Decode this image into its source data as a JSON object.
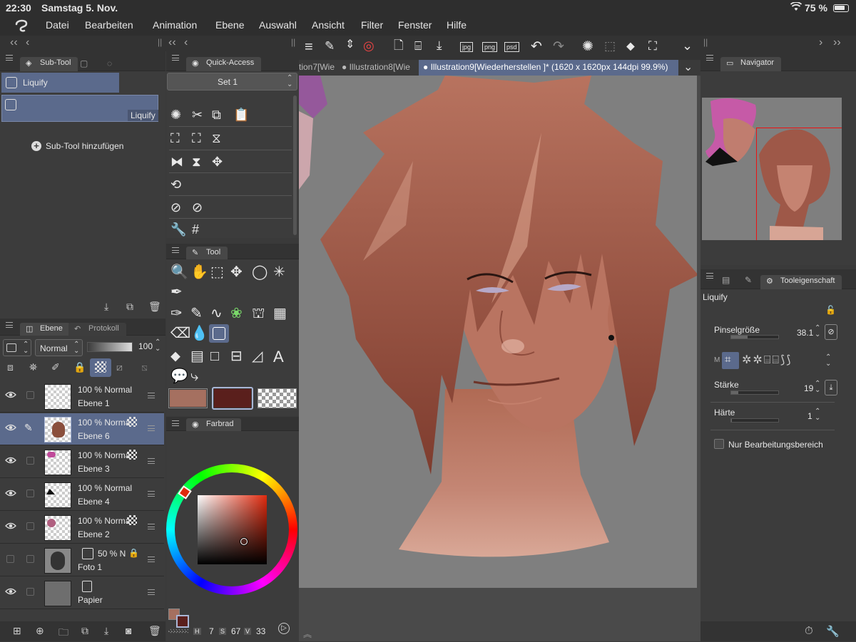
{
  "status": {
    "time": "22:30",
    "date": "Samstag 5. Nov.",
    "battery": "75 %"
  },
  "menu": [
    "Datei",
    "Bearbeiten",
    "Animation",
    "Ebene",
    "Auswahl",
    "Ansicht",
    "Filter",
    "Fenster",
    "Hilfe"
  ],
  "subtool": {
    "tab_label": "Sub-Tool",
    "group_label": "Liquify",
    "item_label": "Liquify",
    "add_label": "Sub-Tool hinzufügen"
  },
  "quick_access": {
    "tab_label": "Quick-Access",
    "set_label": "Set 1"
  },
  "tool_panel": {
    "tab_label": "Tool"
  },
  "color_panel": {
    "tab_label": "Farbrad",
    "main_color": "#a57060",
    "sub_color": "#5a1f1c",
    "h_label": "H",
    "h_value": "7",
    "s_label": "S",
    "s_value": "67",
    "v_label": "V",
    "v_value": "33"
  },
  "layers_panel": {
    "tab_label": "Ebene",
    "history_tab_label": "Protokoll",
    "blend_mode": "Normal",
    "opacity": "100",
    "layers": [
      {
        "opacity_text": "100 % Normal",
        "name": "Ebene 1"
      },
      {
        "opacity_text": "100 % Norma",
        "name": "Ebene 6"
      },
      {
        "opacity_text": "100 % Norma",
        "name": "Ebene 3"
      },
      {
        "opacity_text": "100 % Normal",
        "name": "Ebene 4"
      },
      {
        "opacity_text": "100 % Norma",
        "name": "Ebene 2"
      },
      {
        "opacity_text": "50 % N",
        "name": "Foto 1"
      },
      {
        "opacity_text": "",
        "name": "Papier"
      }
    ]
  },
  "canvas_tabs": [
    {
      "label": "tion7[Wie"
    },
    {
      "label": "Illustration8[Wie"
    },
    {
      "label": "Illustration9[Wiederherstellen ]* (1620 x 1620px 144dpi 99.9%)"
    }
  ],
  "navigator": {
    "tab_label": "Navigator"
  },
  "tool_props": {
    "tab_label": "Tooleigenschaft",
    "tool_name": "Liquify",
    "brush_size_label": "Pinselgröße",
    "brush_size_value": "38.1",
    "brush_size_fraction": 0.35,
    "mode_label": "M",
    "strength_label": "Stärke",
    "strength_value": "19",
    "strength_fraction": 0.15,
    "hardness_label": "Härte",
    "hardness_value": "1",
    "hardness_fraction": 0.02,
    "edit_area_label": "Nur Bearbeitungsbereich"
  },
  "colors": {
    "accent": "#5b6a8c",
    "canvas_gray": "#808080"
  }
}
